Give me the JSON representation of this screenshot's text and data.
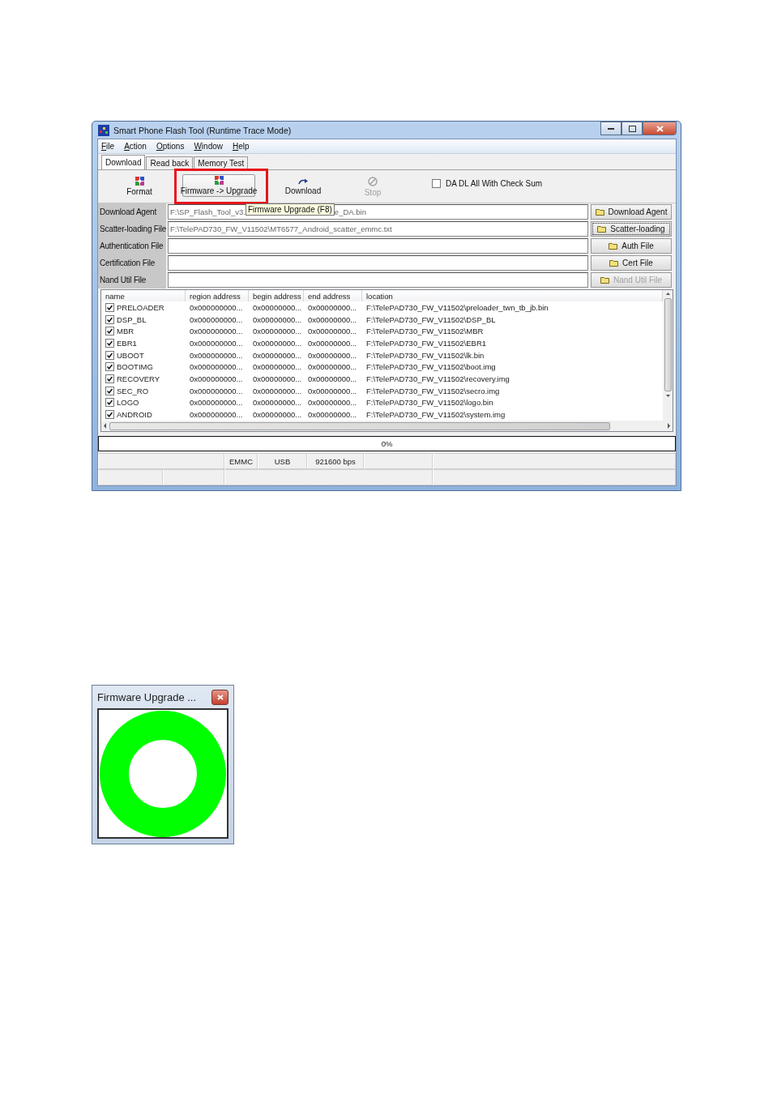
{
  "window": {
    "title": "Smart Phone Flash Tool (Runtime Trace Mode)"
  },
  "menu": [
    "File",
    "Action",
    "Options",
    "Window",
    "Help"
  ],
  "tabs": [
    {
      "label": "Download",
      "selected": true
    },
    {
      "label": "Read back",
      "selected": false
    },
    {
      "label": "Memory Test",
      "selected": false
    }
  ],
  "toolbar": {
    "buttons": [
      {
        "label": "Format",
        "disabled": false,
        "highlighted": false
      },
      {
        "label": "Firmware -> Upgrade",
        "disabled": false,
        "highlighted": true
      },
      {
        "label": "Download",
        "disabled": false,
        "highlighted": false
      },
      {
        "label": "Stop",
        "disabled": true,
        "highlighted": false
      }
    ],
    "checkbox": {
      "label": "DA DL All With Check Sum",
      "checked": false
    }
  },
  "tooltip": "Firmware Upgrade (F8)",
  "files": [
    {
      "label": "Download Agent",
      "value_start": "F:\\SP_Flash_Tool_v3.",
      "value_end": "e_DA.bin",
      "button": "Download Agent",
      "disabled": false,
      "focused": false
    },
    {
      "label": "Scatter-loading File",
      "value_start": "F:\\TelePAD730_FW_V11502\\MT6577_Android_scatter_emmc.txt",
      "button": "Scatter-loading",
      "disabled": false,
      "focused": true
    },
    {
      "label": "Authentication File",
      "button": "Auth File",
      "disabled": false,
      "focused": false
    },
    {
      "label": "Certification File",
      "button": "Cert File",
      "disabled": false,
      "focused": false
    },
    {
      "label": "Nand Util File",
      "button": "Nand Util File",
      "disabled": true,
      "focused": false
    }
  ],
  "table": {
    "columns": [
      "name",
      "region address",
      "begin address",
      "end address",
      "location"
    ],
    "rows": [
      {
        "checked": true,
        "name": "PRELOADER",
        "region": "0x000000000...",
        "begin": "0x00000000...",
        "end": "0x00000000...",
        "location": "F:\\TelePAD730_FW_V11502\\preloader_twn_tb_jb.bin"
      },
      {
        "checked": true,
        "name": "DSP_BL",
        "region": "0x000000000...",
        "begin": "0x00000000...",
        "end": "0x00000000...",
        "location": "F:\\TelePAD730_FW_V11502\\DSP_BL"
      },
      {
        "checked": true,
        "name": "MBR",
        "region": "0x000000000...",
        "begin": "0x00000000...",
        "end": "0x00000000...",
        "location": "F:\\TelePAD730_FW_V11502\\MBR"
      },
      {
        "checked": true,
        "name": "EBR1",
        "region": "0x000000000...",
        "begin": "0x00000000...",
        "end": "0x00000000...",
        "location": "F:\\TelePAD730_FW_V11502\\EBR1"
      },
      {
        "checked": true,
        "name": "UBOOT",
        "region": "0x000000000...",
        "begin": "0x00000000...",
        "end": "0x00000000...",
        "location": "F:\\TelePAD730_FW_V11502\\lk.bin"
      },
      {
        "checked": true,
        "name": "BOOTIMG",
        "region": "0x000000000...",
        "begin": "0x00000000...",
        "end": "0x00000000...",
        "location": "F:\\TelePAD730_FW_V11502\\boot.img"
      },
      {
        "checked": true,
        "name": "RECOVERY",
        "region": "0x000000000...",
        "begin": "0x00000000...",
        "end": "0x00000000...",
        "location": "F:\\TelePAD730_FW_V11502\\recovery.img"
      },
      {
        "checked": true,
        "name": "SEC_RO",
        "region": "0x000000000...",
        "begin": "0x00000000...",
        "end": "0x00000000...",
        "location": "F:\\TelePAD730_FW_V11502\\secro.img"
      },
      {
        "checked": true,
        "name": "LOGO",
        "region": "0x000000000...",
        "begin": "0x00000000...",
        "end": "0x00000000...",
        "location": "F:\\TelePAD730_FW_V11502\\logo.bin"
      },
      {
        "checked": true,
        "name": "ANDROID",
        "region": "0x000000000...",
        "begin": "0x00000000...",
        "end": "0x00000000...",
        "location": "F:\\TelePAD730_FW_V11502\\system.img"
      }
    ]
  },
  "progress": {
    "level": 0,
    "text": "0%"
  },
  "status_bar": [
    "EMMC",
    "USB",
    "921600 bps"
  ],
  "dialog": {
    "title": "Firmware Upgrade ..."
  }
}
